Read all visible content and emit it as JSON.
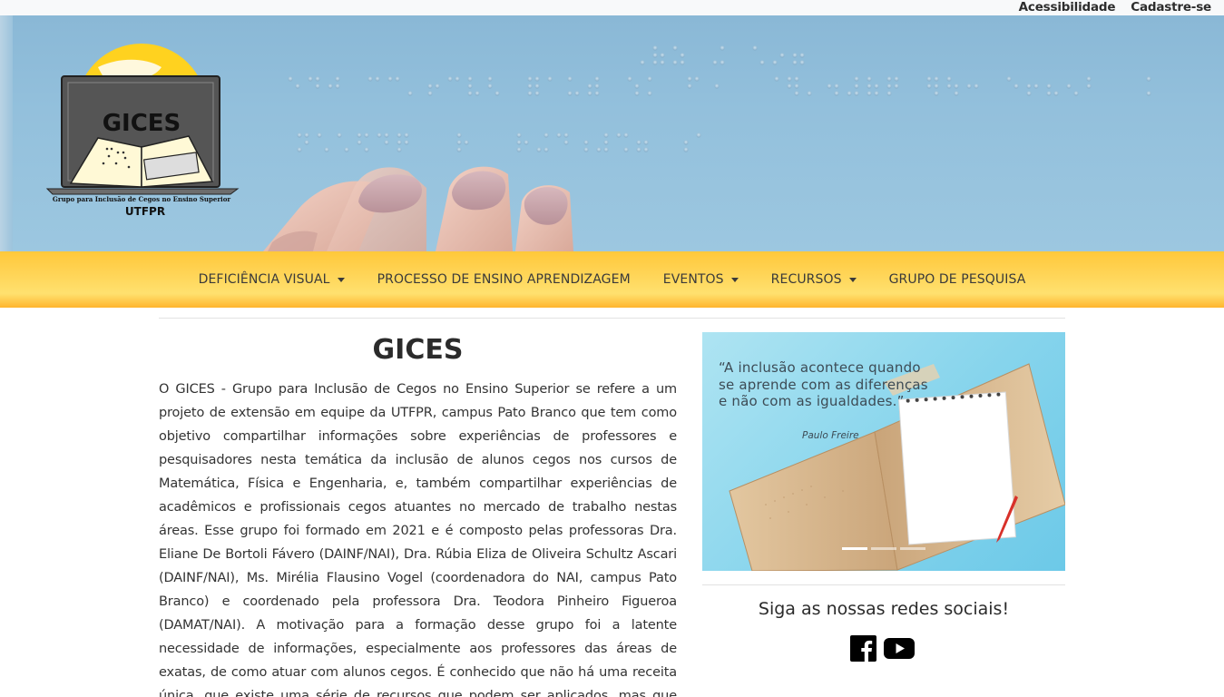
{
  "topbar": {
    "links": [
      "Acessibilidade",
      "Cadastre-se"
    ]
  },
  "logo": {
    "name": "GICES",
    "subtitle": "Grupo para Inclusão de Cegos no Ensino Superior",
    "institution": "UTFPR"
  },
  "nav": {
    "items": [
      {
        "label": "DEFICIÊNCIA VISUAL",
        "dropdown": true
      },
      {
        "label": "PROCESSO DE ENSINO APRENDIZAGEM",
        "dropdown": false
      },
      {
        "label": "EVENTOS",
        "dropdown": true
      },
      {
        "label": "RECURSOS",
        "dropdown": true
      },
      {
        "label": "GRUPO DE PESQUISA",
        "dropdown": false
      }
    ]
  },
  "main": {
    "title": "GICES",
    "body": "O GICES - Grupo para Inclusão de Cegos no Ensino Superior se refere a um projeto de extensão em equipe da UTFPR, campus Pato Branco que tem como objetivo compartilhar informações sobre experiências de professores e pesquisadores nesta temática da inclusão de alunos cegos nos cursos de Matemática, Física e Engenharia, e, também compartilhar experiências de acadêmicos e profissionais cegos atuantes no mercado de trabalho nestas áreas. Esse grupo foi formado em 2021 e é composto pelas professoras Dra. Eliane De Bortoli Fávero (DAINF/NAI), Dra. Rúbia Eliza de Oliveira Schultz Ascari (DAINF/NAI), Ms. Mirélia Flausino Vogel (coordenadora do NAI, campus Pato Branco) e coordenado pela professora Dra. Teodora Pinheiro Figueroa (DAMAT/NAI). A motivação para a formação desse grupo foi a latente necessidade de informações, especialmente aos professores das áreas de exatas, de como atuar com alunos cegos. É conhecido que não há uma receita única, que existe uma série de recursos que podem ser aplicados, mas que torna-se"
  },
  "carousel": {
    "quote": "“A inclusão acontece quando se aprende com as diferenças e não com as igualdades.”",
    "author": "Paulo Freire",
    "slides": 3,
    "active_slide": 1
  },
  "social": {
    "title": "Siga as nossas redes sociais!",
    "icons": [
      "facebook-icon",
      "youtube-icon"
    ]
  },
  "colors": {
    "nav_yellow": "#ffd65a",
    "banner_blue": "#93c0dc",
    "carousel_blue": "#86d4ec"
  }
}
